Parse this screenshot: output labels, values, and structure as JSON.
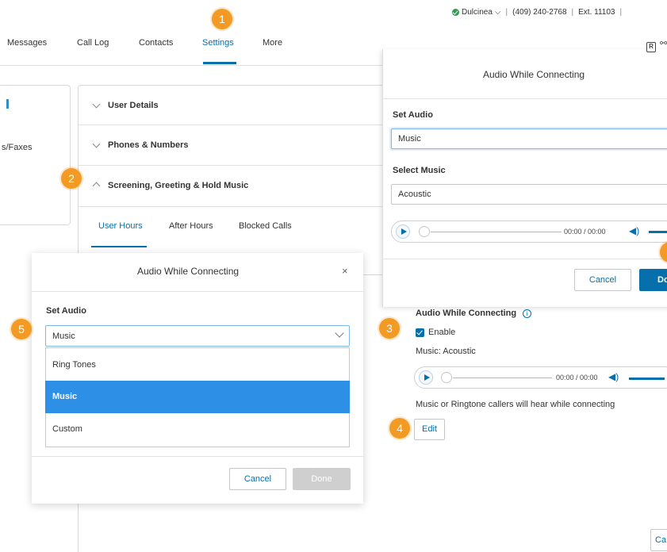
{
  "status": {
    "user": "Dulcinea",
    "phone": "(409) 240-2768",
    "ext": "Ext. 11103",
    "sep": "|",
    "caret": "⌵"
  },
  "nav": {
    "items": [
      "Messages",
      "Call Log",
      "Contacts",
      "Settings",
      "More"
    ],
    "active": "Settings"
  },
  "side_panel": {
    "label": "s/Faxes"
  },
  "accordion": {
    "sections": [
      "User Details",
      "Phones & Numbers",
      "Screening, Greeting & Hold Music"
    ],
    "tabs": [
      "User Hours",
      "After Hours",
      "Blocked Calls"
    ]
  },
  "badges": {
    "b1": "1",
    "b2": "2",
    "b3": "3",
    "b4": "4",
    "b5": "5"
  },
  "right_modal": {
    "title": "Audio While Connecting",
    "set_audio_label": "Set Audio",
    "set_audio_value": "Music",
    "select_music_label": "Select Music",
    "select_music_value": "Acoustic",
    "time": "00:00 / 00:00",
    "cancel": "Cancel",
    "done": "Do"
  },
  "details": {
    "heading": "Audio While Connecting",
    "enable_label": "Enable",
    "music": "Music: Acoustic",
    "time": "00:00 / 00:00",
    "description": "Music or Ringtone callers will hear while connecting",
    "edit": "Edit",
    "bottom_cancel": "Ca"
  },
  "left_modal": {
    "title": "Audio While Connecting",
    "close": "×",
    "set_audio_label": "Set Audio",
    "selected": "Music",
    "options": [
      "Ring Tones",
      "Music",
      "Custom"
    ],
    "cancel": "Cancel",
    "done": "Done"
  },
  "colors": {
    "accent": "#066fac",
    "badge": "#f39a24",
    "selected_option": "#2e8fe6",
    "status_dot": "#2e9b4f"
  },
  "icons": [
    "check-circle-icon",
    "chevron-down-icon",
    "chevron-up-icon",
    "play-icon",
    "volume-icon",
    "info-icon",
    "close-icon",
    "checkbox-checked-icon",
    "r-icon"
  ]
}
